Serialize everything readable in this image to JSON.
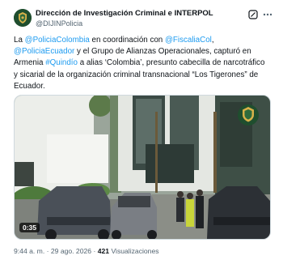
{
  "author": {
    "name": "Dirección de Investigación Criminal e INTERPOL",
    "handle": "@DIJINPolicia"
  },
  "tweet": {
    "segments": [
      {
        "text": "La ",
        "link": false
      },
      {
        "text": "@PoliciaColombia",
        "link": true
      },
      {
        "text": " en coordinación con ",
        "link": false
      },
      {
        "text": "@FiscaliaCol",
        "link": true
      },
      {
        "text": ", ",
        "link": false
      },
      {
        "text": "@PoliciaEcuador",
        "link": true
      },
      {
        "text": " y el Grupo de Alianzas Operacionales, capturó en Armenia ",
        "link": false
      },
      {
        "text": "#Quindío",
        "link": true
      },
      {
        "text": " a alias ‘Colombia’, presunto cabecilla de narcotráfico y sicarial de la organización criminal transnacional “Los Tigerones” de Ecuador.",
        "link": false
      }
    ]
  },
  "video": {
    "duration": "0:35"
  },
  "meta": {
    "time": "9:44 a. m.",
    "separator": "·",
    "date": "29 ago. 2026",
    "views_count": "421",
    "views_label": "Visualizaciones"
  },
  "icons": {
    "grok": "grok-icon",
    "more": "more-options-icon",
    "avatar": "police-badge-icon"
  },
  "colors": {
    "link": "#1d9bf0",
    "text": "#0f1419",
    "muted": "#536471"
  }
}
